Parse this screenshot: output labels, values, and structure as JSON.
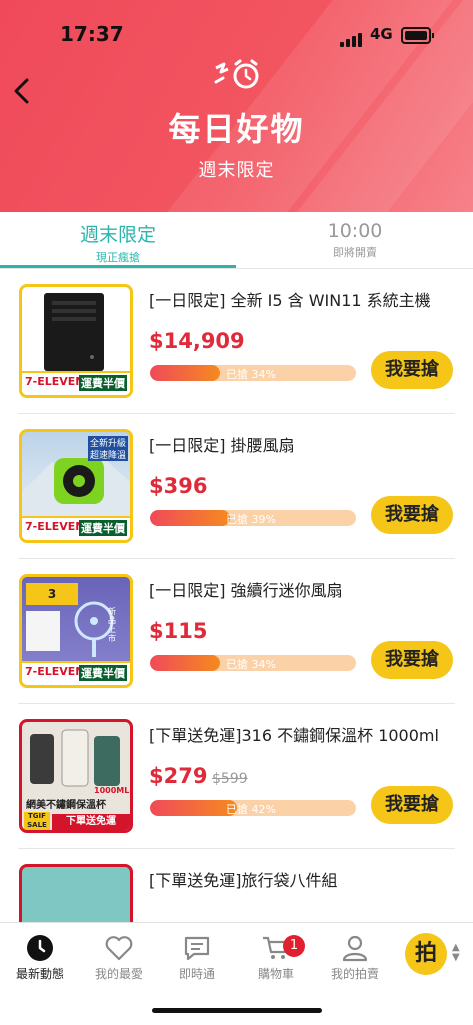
{
  "status": {
    "time": "17:37",
    "network": "4G"
  },
  "header": {
    "title": "每日好物",
    "subtitle": "週末限定",
    "accent": "#f04a5a"
  },
  "tabs": [
    {
      "label": "週末限定",
      "sub": "現正瘋搶",
      "active": true
    },
    {
      "label": "10:00",
      "sub": "即將開賣",
      "active": false
    }
  ],
  "ribbon": {
    "left": "7-ELEVEN",
    "right": "運費半價"
  },
  "thumb_texts": {
    "p2_top1": "全新升級",
    "p2_top2": "超速降溫",
    "p3_badge": "3",
    "p3_tag": "新品上市",
    "p4_title": "網美不鏽鋼保溫杯",
    "p4_size": "1000ML",
    "p4_tgif1": "TGIF",
    "p4_tgif2": "SALE",
    "p4_free": "下單送免運"
  },
  "products": [
    {
      "name": "[一日限定] 全新 I5 含 WIN11 系統主機",
      "price": "$14,909",
      "orig": "",
      "progress": 34,
      "progress_label": "已搶 34%",
      "buy": "我要搶"
    },
    {
      "name": "[一日限定] 掛腰風扇",
      "price": "$396",
      "orig": "",
      "progress": 39,
      "progress_label": "已搶 39%",
      "buy": "我要搶"
    },
    {
      "name": "[一日限定] 強續行迷你風扇",
      "price": "$115",
      "orig": "",
      "progress": 34,
      "progress_label": "已搶 34%",
      "buy": "我要搶"
    },
    {
      "name": "[下單送免運]316 不鏽鋼保溫杯 1000ml",
      "price": "$279",
      "orig": "$599",
      "progress": 42,
      "progress_label": "已搶 42%",
      "buy": "我要搶"
    },
    {
      "name": "[下單送免運]旅行袋八件組"
    }
  ],
  "tabbar": [
    {
      "label": "最新動態",
      "icon": "clock-icon"
    },
    {
      "label": "我的最愛",
      "icon": "heart-icon"
    },
    {
      "label": "即時通",
      "icon": "chat-icon"
    },
    {
      "label": "購物車",
      "icon": "cart-icon",
      "badge": "1"
    },
    {
      "label": "我的拍賣",
      "icon": "person-icon"
    }
  ],
  "fab": {
    "label": "拍"
  }
}
